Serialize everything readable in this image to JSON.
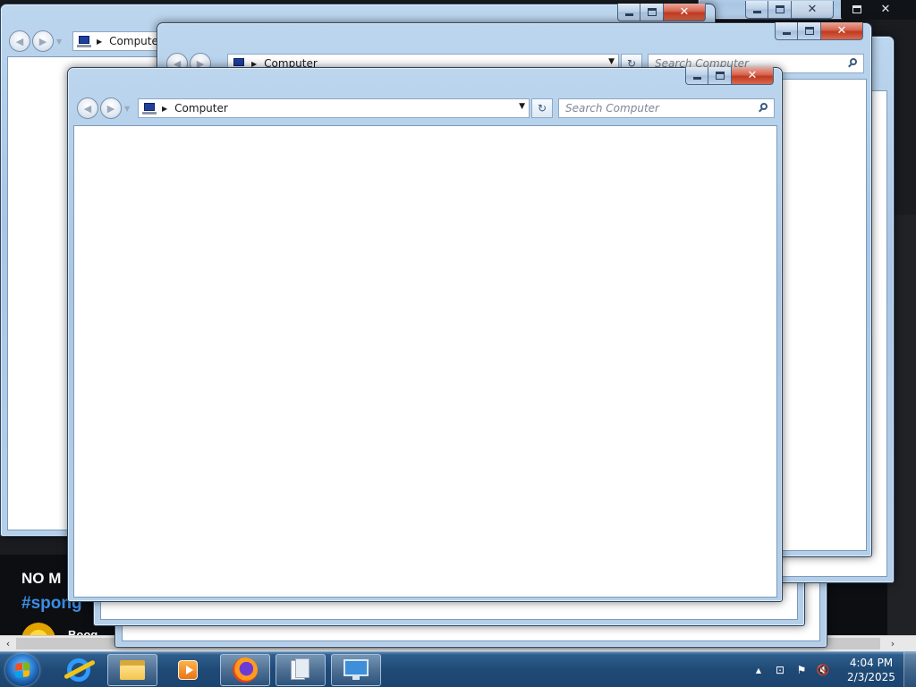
{
  "background_page": {
    "headline": "NO M",
    "hashtag": "#spong",
    "author": "Boog",
    "scroll_left": "‹",
    "scroll_right": "›"
  },
  "explorer": {
    "location": "Computer",
    "search_placeholder": "Search Computer",
    "back_glyph": "◀",
    "forward_glyph": "▶",
    "history_glyph": "▼",
    "crumb_separator": "▶",
    "address_dropdown": "▼",
    "refresh_glyph": "↻",
    "close_glyph": "✕"
  },
  "taskbar": {
    "pinned": [
      "start",
      "internet-explorer",
      "windows-explorer",
      "media-player",
      "firefox",
      "document-viewer",
      "remote-desktop"
    ],
    "tray": {
      "show_hidden": "▲",
      "network_glyph": "⊡",
      "flag_glyph": "⚑",
      "volume_glyph": "🔇"
    },
    "time": "4:04 PM",
    "date": "2/3/2025"
  },
  "colors": {
    "close_button": "#c0391f",
    "taskbar": "#1f4a76",
    "window_frame": "#a9c6e4"
  }
}
